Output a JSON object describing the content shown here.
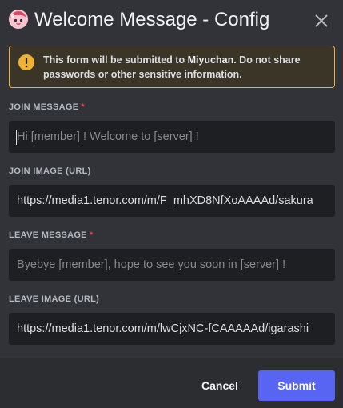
{
  "header": {
    "title": "Welcome Message - Config",
    "close_icon": "close-icon",
    "app_icon": "bot-avatar"
  },
  "warning": {
    "icon": "warning-icon",
    "prefix": "This form will be submitted to ",
    "app_name": "Miyuchan",
    "suffix": ". Do not share passwords or other sensitive information."
  },
  "fields": [
    {
      "label": "JOIN MESSAGE",
      "required_mark": "*",
      "value": "",
      "placeholder": "Hi [member] ! Welcome to [server] !"
    },
    {
      "label": "JOIN IMAGE (URL)",
      "value": "https://media1.tenor.com/m/F_mhXD8NfXoAAAAd/sakura",
      "placeholder": ""
    },
    {
      "label": "LEAVE MESSAGE",
      "required_mark": "*",
      "value": "",
      "placeholder": "Byebye [member], hope to see you soon in [server] !"
    },
    {
      "label": "LEAVE IMAGE (URL)",
      "value": "https://media1.tenor.com/m/lwCjxNC-fCAAAAAd/igarashi",
      "placeholder": ""
    }
  ],
  "footer": {
    "cancel_label": "Cancel",
    "submit_label": "Submit"
  },
  "colors": {
    "accent": "#5865f2",
    "warning": "#f0b232",
    "required": "#f23f43",
    "background": "#313338",
    "input_background": "#1e1f22"
  }
}
